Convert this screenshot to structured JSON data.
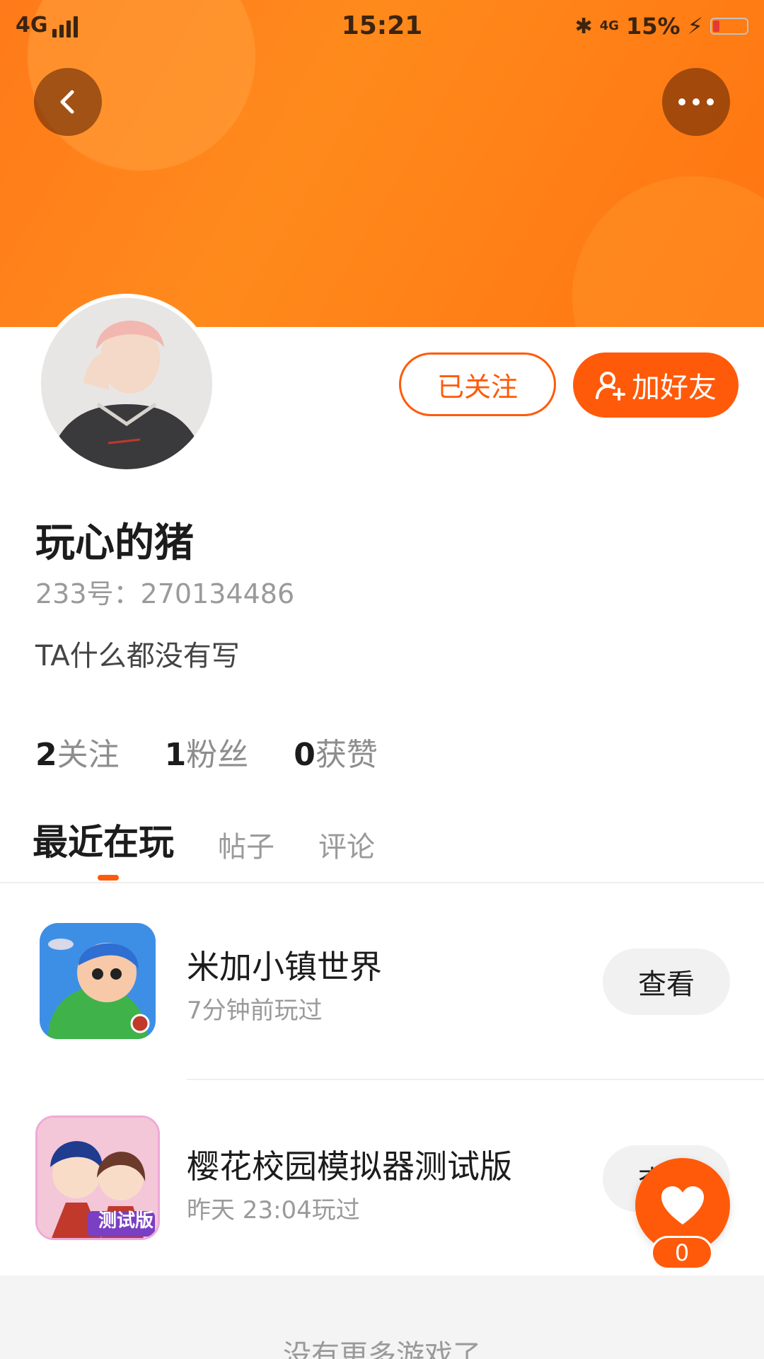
{
  "status_bar": {
    "network": "4G",
    "time": "15:21",
    "network_right": "4G",
    "battery": "15%"
  },
  "header": {
    "back_icon": "chevron-left-icon",
    "more_icon": "more-horizontal-icon"
  },
  "profile": {
    "follow_label": "已关注",
    "add_friend_label": "加好友",
    "name": "玩心的猪",
    "uid": "233号：270134486",
    "bio": "TA什么都没有写"
  },
  "stats": [
    {
      "num": "2",
      "label": "关注"
    },
    {
      "num": "1",
      "label": "粉丝"
    },
    {
      "num": "0",
      "label": "获赞"
    }
  ],
  "tabs": [
    {
      "label": "最近在玩"
    },
    {
      "label": "帖子"
    },
    {
      "label": "评论"
    }
  ],
  "games": [
    {
      "title": "米加小镇世界",
      "sub": "7分钟前玩过",
      "action": "查看"
    },
    {
      "title": "樱花校园模拟器测试版",
      "sub": "昨天 23:04玩过",
      "action": "查看",
      "badge": "测试版"
    }
  ],
  "footer": {
    "text": "没有更多游戏了"
  },
  "like": {
    "count": "0"
  },
  "colors": {
    "accent": "#ff5a0a",
    "banner": "#ff7a1a"
  }
}
